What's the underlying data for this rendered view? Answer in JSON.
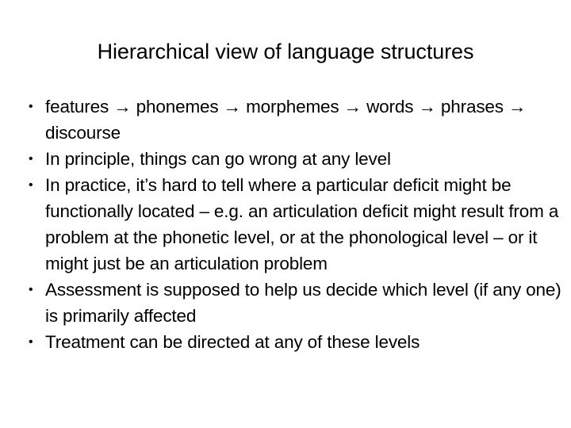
{
  "slide": {
    "title": "Hierarchical view of language structures",
    "bullet_marker": "•",
    "background_color": "#ffffff",
    "text_color": "#000000",
    "bullets": [
      "features → phonemes → morphemes → words → phrases → discourse",
      "In principle, things can go wrong at any level",
      "In practice, it’s hard to tell where a particular deficit might be functionally located – e.g. an articulation deficit might result from a problem at the phonetic level, or at the phonological level – or it might just be an articulation problem",
      "Assessment is supposed to help us decide which level (if any one) is primarily affected",
      "Treatment can be directed at any of these levels"
    ]
  }
}
